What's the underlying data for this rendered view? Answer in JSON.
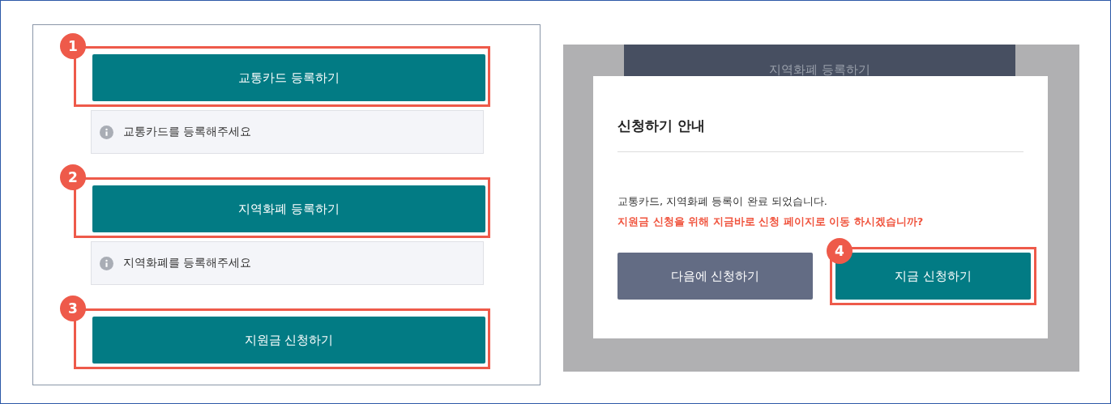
{
  "registration_steps": [
    {
      "marker": "1",
      "button": "교통카드 등록하기",
      "hint": "교통카드를 등록해주세요"
    },
    {
      "marker": "2",
      "button": "지역화폐 등록하기",
      "hint": "지역화폐를 등록해주세요"
    },
    {
      "marker": "3",
      "button": "지원금 신청하기"
    }
  ],
  "background_button": "지역화폐 등록하기",
  "dialog": {
    "title": "신청하기 안내",
    "message": "교통카드, 지역화폐 등록이 완료 되었습니다.",
    "prompt": "지원금 신청을 위해 지금바로 신청 페이지로 이동 하시겠습니까?",
    "buttons": [
      {
        "label": "다음에 신청하기",
        "kind": "secondary"
      },
      {
        "label": "지금 신청하기",
        "kind": "primary",
        "marker": "4"
      }
    ]
  }
}
